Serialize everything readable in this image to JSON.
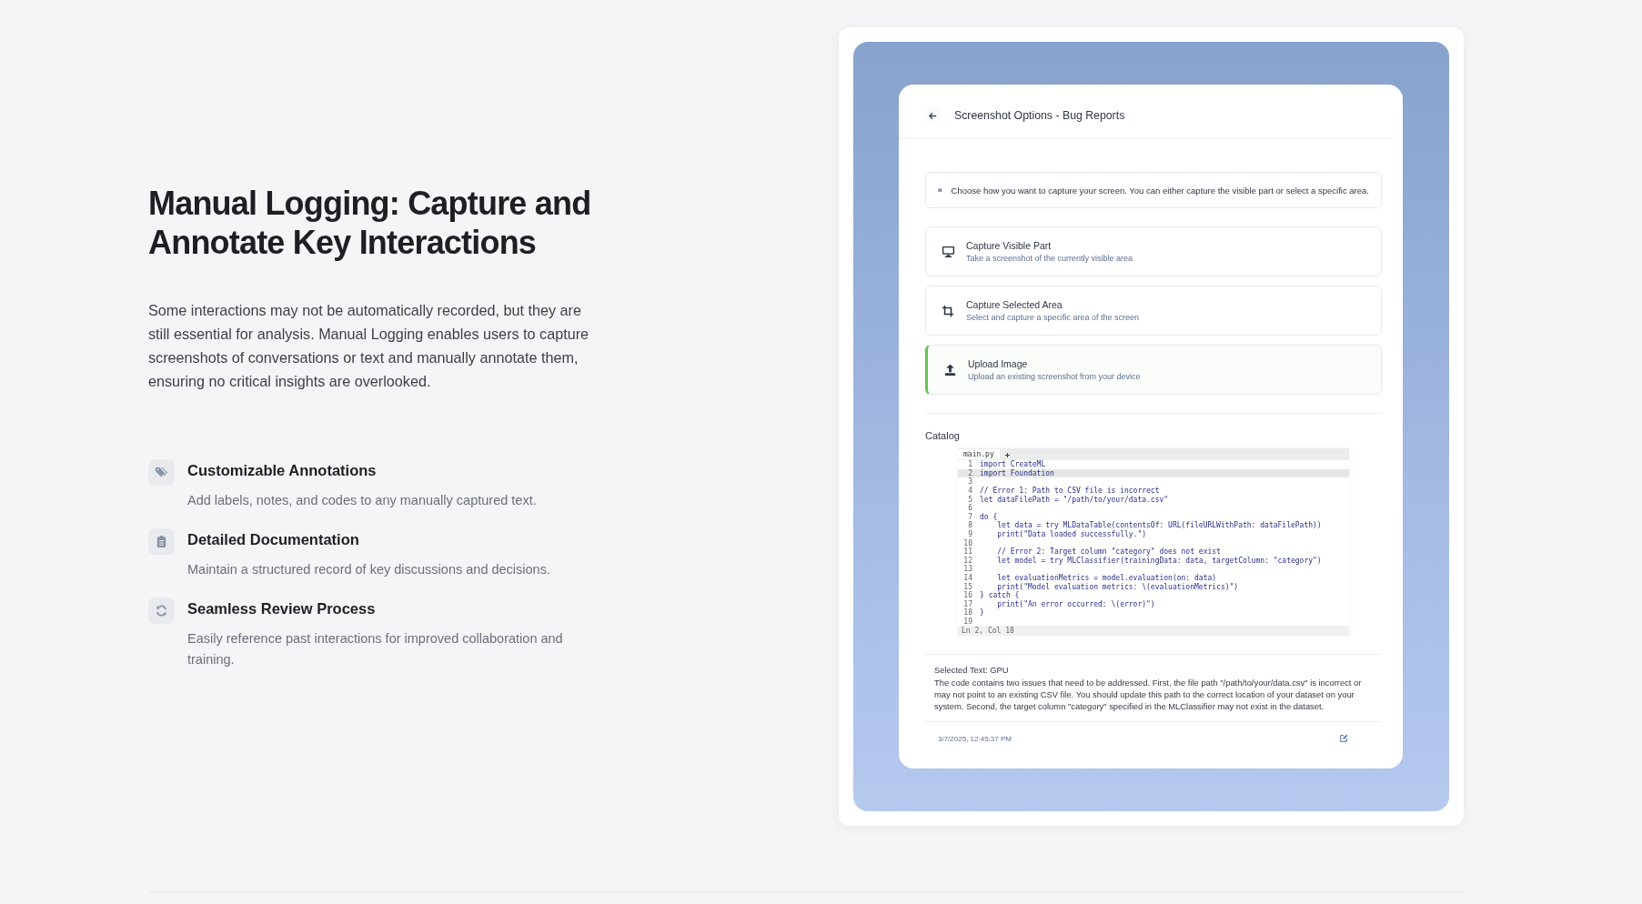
{
  "heading": "Manual Logging: Capture and Annotate Key Interactions",
  "intro": "Some interactions may not be automatically recorded, but they are still essential for analysis. Manual Logging enables users to capture screenshots of conversations or text and manually annotate them, ensuring no critical insights are overlooked.",
  "features": [
    {
      "title": "Customizable Annotations",
      "description": "Add labels, notes, and codes to any manually captured text."
    },
    {
      "title": "Detailed Documentation",
      "description": "Maintain a structured record of key discussions and decisions."
    },
    {
      "title": "Seamless Review Process",
      "description": "Easily reference past interactions for improved collaboration and training."
    }
  ],
  "panel": {
    "title": "Screenshot Options - Bug Reports",
    "info": "Choose how you want to capture your screen. You can either capture the visible part or select a specific area.",
    "options": [
      {
        "title": "Capture Visible Part",
        "description": "Take a screenshot of the currently visible area",
        "selected": false
      },
      {
        "title": "Capture Selected Area",
        "description": "Select and capture a specific area of the screen",
        "selected": false
      },
      {
        "title": "Upload Image",
        "description": "Upload an existing screenshot from your device",
        "selected": true
      }
    ],
    "catalog_label": "Catalog",
    "code_image": {
      "tab": "main.py",
      "add_tab": "+",
      "status": "Ln 2, Col 18",
      "lines": [
        {
          "number": "1",
          "code": "import CreateML",
          "selected": false
        },
        {
          "number": "2",
          "code": "import Foundation",
          "selected": true
        },
        {
          "number": "3",
          "selected": false
        },
        {
          "number": "4",
          "code": "// Error 1: Path to CSV file is incorrect",
          "selected": false
        },
        {
          "number": "5",
          "code": "let dataFilePath = \"/path/to/your/data.csv\"",
          "selected": false
        },
        {
          "number": "6",
          "selected": false
        },
        {
          "number": "7",
          "code": "do {",
          "selected": false
        },
        {
          "number": "8",
          "code": "    let data = try MLDataTable(contentsOf: URL(fileURLWithPath: dataFilePath))",
          "selected": false
        },
        {
          "number": "9",
          "code": "    print(\"Data loaded successfully.\")",
          "selected": false
        },
        {
          "number": "10",
          "selected": false
        },
        {
          "number": "11",
          "code": "    // Error 2: Target column \"category\" does not exist",
          "selected": false
        },
        {
          "number": "12",
          "code": "    let model = try MLClassifier(trainingData: data, targetColumn: \"category\")",
          "selected": false
        },
        {
          "number": "13",
          "selected": false
        },
        {
          "number": "14",
          "code": "    let evaluationMetrics = model.evaluation(on: data)",
          "selected": false
        },
        {
          "number": "15",
          "code": "    print(\"Model evaluation metrics: \\(evaluationMetrics)\")",
          "selected": false
        },
        {
          "number": "16",
          "code": "} catch {",
          "selected": false
        },
        {
          "number": "17",
          "code": "    print(\"An error occurred: \\(error)\")",
          "selected": false
        },
        {
          "number": "18",
          "code": "}",
          "selected": false
        },
        {
          "number": "19",
          "selected": false
        }
      ]
    },
    "selected_text_label": "Selected Text: GPU",
    "selected_text": "The code contains two issues that need to be addressed. First, the file path \"/path/to/your/data.csv\" is incorrect or may not point to an existing CSV file. You should update this path to the correct location of your dataset on your system. Second, the target column \"category\" specified in the MLClassifier may not exist in the dataset.",
    "timestamp": "3/7/2025, 12:45:37 PM"
  }
}
